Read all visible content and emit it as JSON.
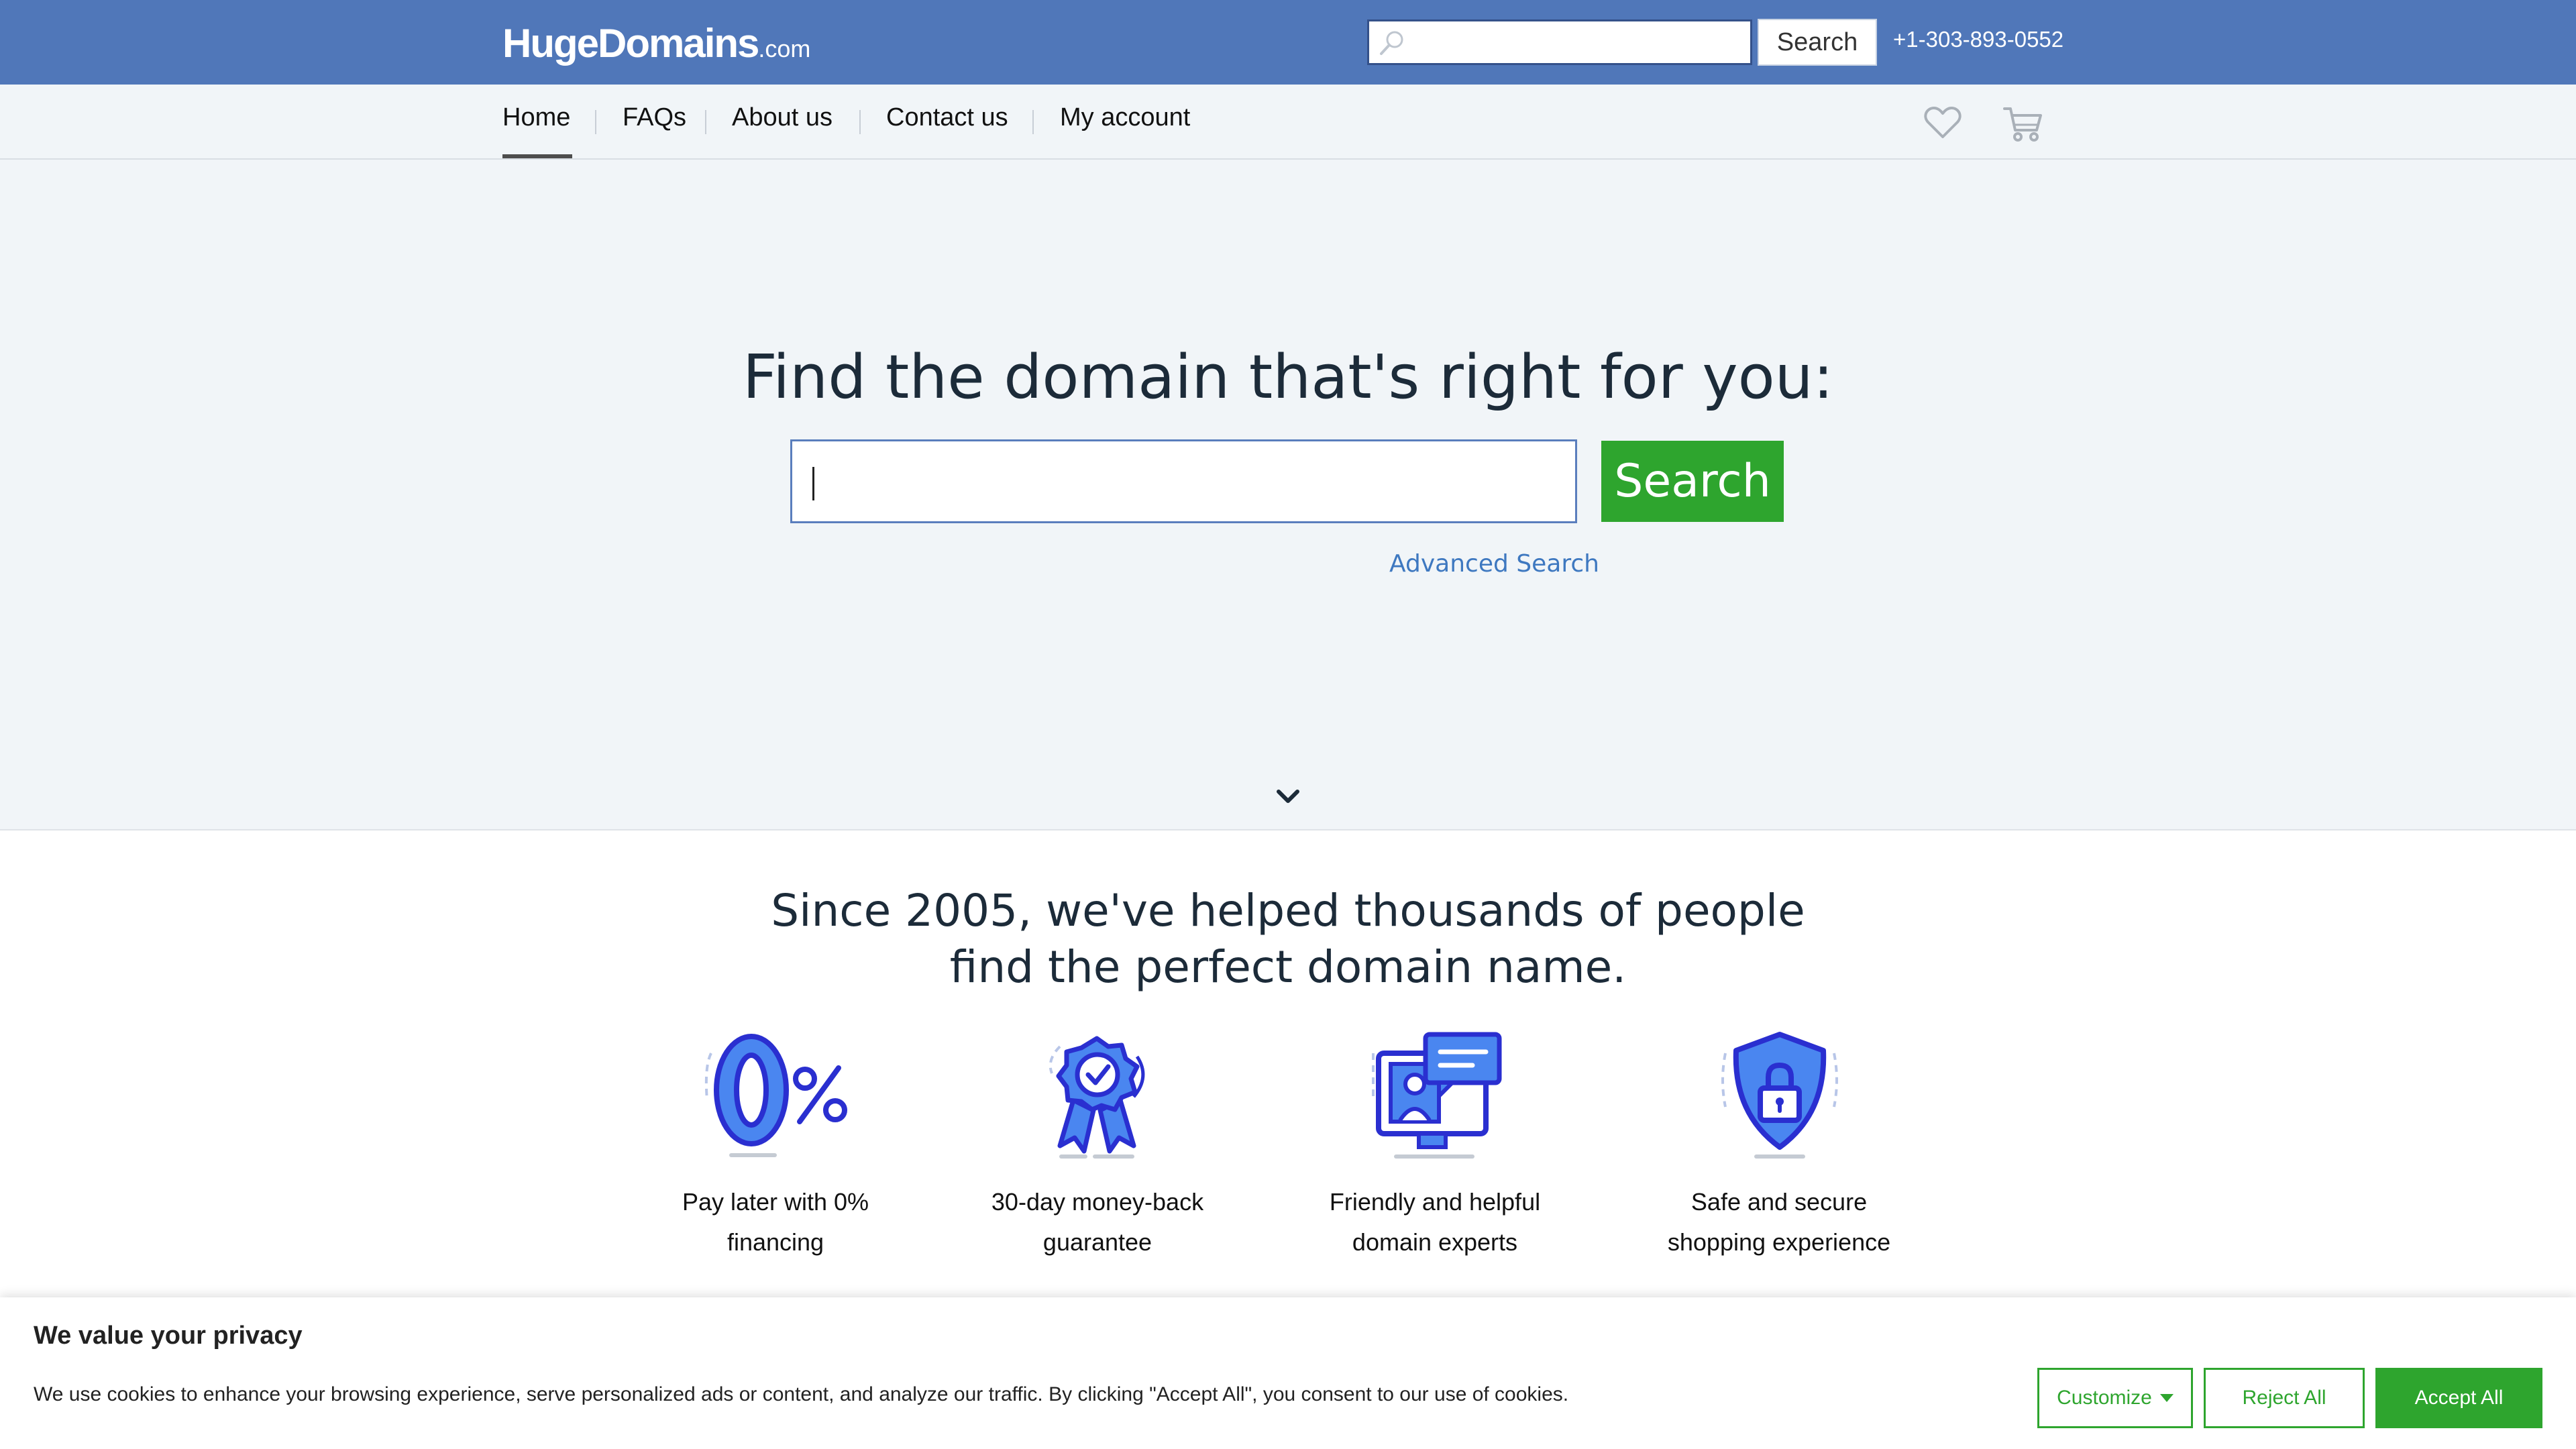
{
  "header": {
    "logo_main": "HugeDomains",
    "logo_tld": ".com",
    "search_placeholder": "",
    "search_button": "Search",
    "phone": "+1-303-893-0552",
    "bg_color": "#5077b9"
  },
  "nav": {
    "items": [
      {
        "label": "Home",
        "active": true
      },
      {
        "label": "FAQs",
        "active": false
      },
      {
        "label": "About us",
        "active": false
      },
      {
        "label": "Contact us",
        "active": false
      },
      {
        "label": "My account",
        "active": false
      }
    ],
    "icons": [
      "heart-icon",
      "cart-icon"
    ]
  },
  "hero": {
    "title": "Find the domain that's right for you:",
    "input_value": "",
    "search_button": "Search",
    "advanced_link": "Advanced Search",
    "scroll_icon": "chevron-down-icon",
    "button_color": "#2ea52e"
  },
  "benefits": {
    "heading_line1": "Since 2005, we've helped thousands of people",
    "heading_line2": "find the perfect domain name.",
    "items": [
      {
        "icon": "zero-percent-icon",
        "line1": "Pay later with 0%",
        "line2": "financing"
      },
      {
        "icon": "award-ribbon-icon",
        "line1": "30-day money-back",
        "line2": "guarantee"
      },
      {
        "icon": "support-chat-icon",
        "line1": "Friendly and helpful",
        "line2": "domain experts"
      },
      {
        "icon": "shield-lock-icon",
        "line1": "Safe and secure",
        "line2": "shopping experience"
      }
    ]
  },
  "cookie_banner": {
    "title": "We value your privacy",
    "text": "We use cookies to enhance your browsing experience, serve personalized ads or content, and analyze our traffic. By clicking \"Accept All\", you consent to our use of cookies.",
    "customize": "Customize",
    "reject": "Reject All",
    "accept": "Accept All",
    "accent_color": "#2ea52e"
  }
}
